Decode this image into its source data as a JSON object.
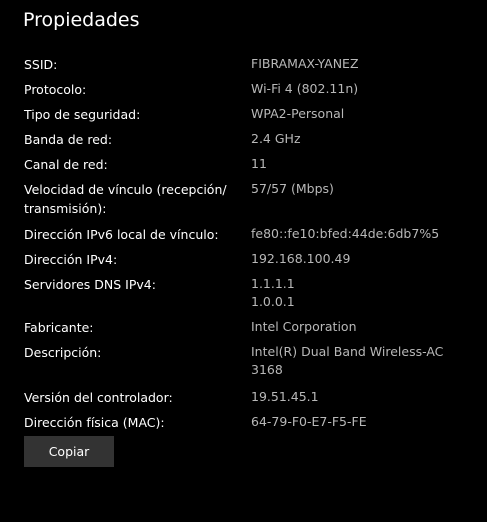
{
  "title": "Propiedades",
  "properties": [
    {
      "label": "SSID:",
      "value": [
        "FIBRAMAX-YANEZ"
      ]
    },
    {
      "label": "Protocolo:",
      "value": [
        "Wi-Fi 4 (802.11n)"
      ]
    },
    {
      "label": "Tipo de seguridad:",
      "value": [
        "WPA2-Personal"
      ]
    },
    {
      "label": "Banda de red:",
      "value": [
        "2.4 GHz"
      ]
    },
    {
      "label": "Canal de red:",
      "value": [
        "11"
      ]
    },
    {
      "label": "Velocidad de vínculo (recepción/ transmisión):",
      "value": [
        "57/57 (Mbps)"
      ]
    },
    {
      "label": "Dirección IPv6 local de vínculo:",
      "value": [
        "fe80::fe10:bfed:44de:6db7%5"
      ]
    },
    {
      "label": "Dirección IPv4:",
      "value": [
        "192.168.100.49"
      ]
    },
    {
      "label": "Servidores DNS IPv4:",
      "value": [
        "1.1.1.1",
        "1.0.0.1"
      ]
    },
    {
      "label": "Fabricante:",
      "value": [
        "Intel Corporation"
      ]
    },
    {
      "label": "Descripción:",
      "value": [
        "Intel(R) Dual Band Wireless-AC",
        "3168"
      ]
    },
    {
      "label": "Versión del controlador:",
      "value": [
        "19.51.45.1"
      ]
    },
    {
      "label": "Dirección física (MAC):",
      "value": [
        "64-79-F0-E7-F5-FE"
      ]
    }
  ],
  "copy_button_label": "Copiar",
  "colors": {
    "background": "#000000",
    "label_text": "#ffffff",
    "value_text": "#b8b8b8",
    "button_bg": "#333333"
  }
}
